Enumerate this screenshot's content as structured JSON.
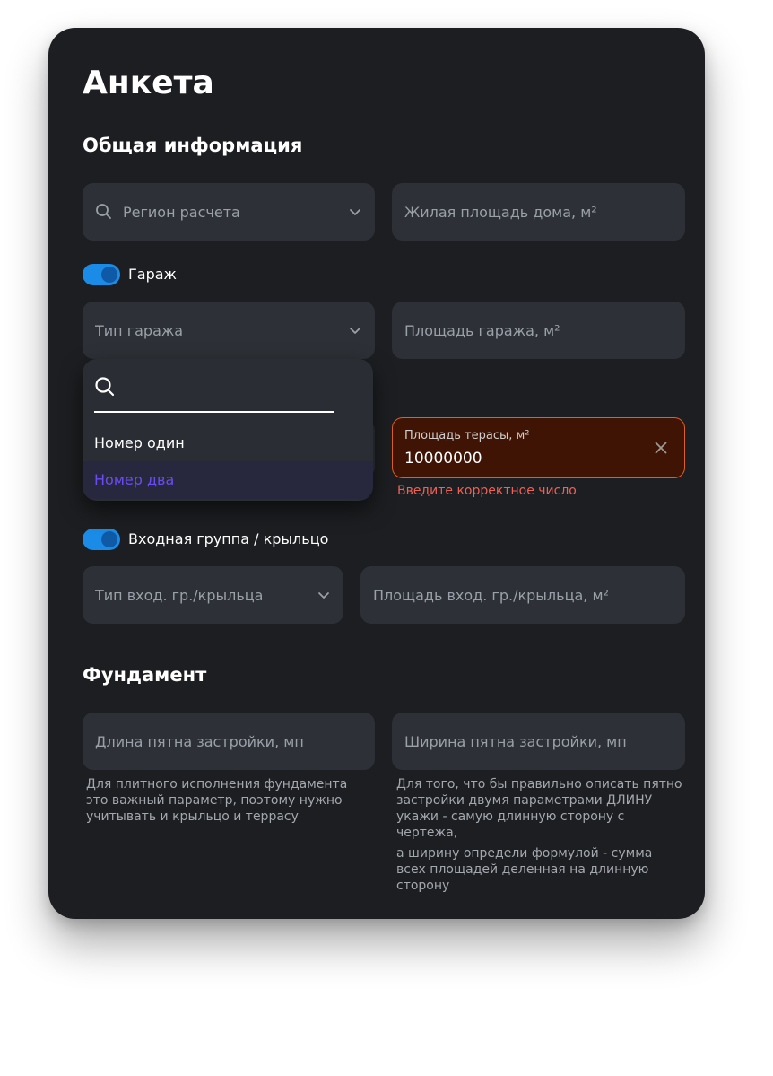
{
  "title": "Анкета",
  "general": {
    "heading": "Общая информация",
    "region": {
      "placeholder": "Регион расчета"
    },
    "living_area": {
      "placeholder": "Жилая площадь дома, м²"
    }
  },
  "garage": {
    "toggle_label": "Гараж",
    "toggle_on": true,
    "type": {
      "placeholder": "Тип гаража"
    },
    "area": {
      "placeholder": "Площадь гаража, м²"
    },
    "dropdown": {
      "search_value": "",
      "options": [
        "Номер один",
        "Номер два"
      ],
      "highlighted": "Номер два"
    }
  },
  "terrace": {
    "label": "Площадь терасы, м²",
    "value": "10000000",
    "error": "Введите корректное число"
  },
  "entrance": {
    "toggle_label": "Входная группа / крыльцо",
    "toggle_on": true,
    "type": {
      "placeholder": "Тип вход. гр./крыльца"
    },
    "area": {
      "placeholder": "Площадь вход. гр./крыльца, м²"
    }
  },
  "foundation": {
    "heading": "Фундамент",
    "length": {
      "placeholder": "Длина пятна застройки, мп",
      "help": "Для плитного исполнения фундамента это важный параметр, поэтому нужно учитывать и крыльцо и террасу"
    },
    "width": {
      "placeholder": "Ширина пятна застройки, мп",
      "help_1": "Для того, что бы правильно описать пятно застройки двумя параметрами ДЛИНУ укажи - самую длинную сторону с чертежа,",
      "help_2": "а ширину определи формулой - сумма всех площадей деленная на длинную сторону"
    }
  },
  "colors": {
    "background": "#1c1e21",
    "field": "#2d3036",
    "accent_toggle": "#1a8be6",
    "highlight_text": "#6a4cf5",
    "error_border": "#e06020",
    "error_fill": "#3f1404",
    "error_text": "#f06055"
  },
  "icons": [
    "search-icon",
    "chevron-down-icon",
    "close-icon"
  ]
}
